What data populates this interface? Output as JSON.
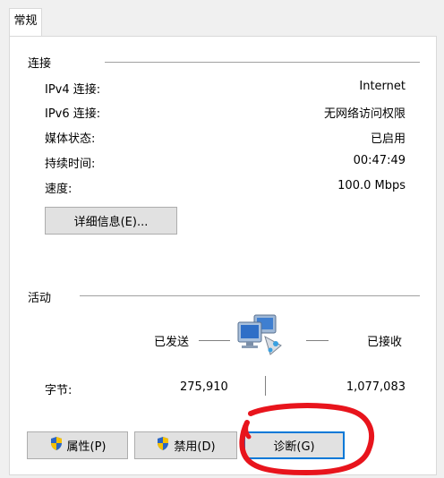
{
  "tab": {
    "label": "常规"
  },
  "connection": {
    "title": "连接",
    "rows": [
      {
        "label": "IPv4 连接:",
        "value": "Internet"
      },
      {
        "label": "IPv6 连接:",
        "value": "无网络访问权限"
      },
      {
        "label": "媒体状态:",
        "value": "已启用"
      },
      {
        "label": "持续时间:",
        "value": "00:47:49"
      },
      {
        "label": "速度:",
        "value": "100.0 Mbps"
      }
    ],
    "details_button": "详细信息(E)..."
  },
  "activity": {
    "title": "活动",
    "sent_label": "已发送",
    "received_label": "已接收",
    "bytes_label": "字节:",
    "bytes_sent": "275,910",
    "bytes_received": "1,077,083",
    "network_icon": "network-computers-icon"
  },
  "buttons": {
    "properties": "属性(P)",
    "disable": "禁用(D)",
    "diagnose": "诊断(G)"
  },
  "colors": {
    "annotation": "#e8141c",
    "focus": "#0078d7"
  }
}
